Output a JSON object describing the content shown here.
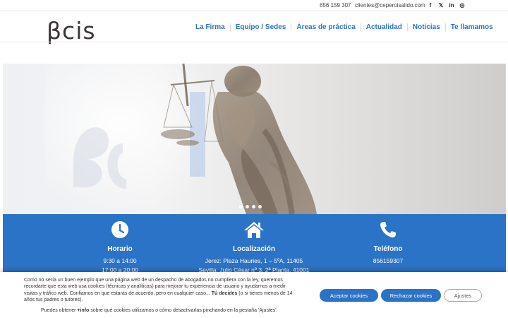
{
  "topbar": {
    "phone": "856 159 307",
    "email": "clientes@ceperoisalido.com",
    "social": [
      {
        "icon": "facebook-icon",
        "glyph": "f"
      },
      {
        "icon": "x-icon",
        "glyph": "𝕏"
      },
      {
        "icon": "linkedin-icon",
        "glyph": "in"
      },
      {
        "icon": "instagram-icon",
        "glyph": "◎"
      }
    ]
  },
  "logo": {
    "text": "βcis"
  },
  "nav": {
    "items": [
      "La Firma",
      "Equipo / Sedes",
      "Áreas de práctica",
      "Actualidad",
      "Noticias",
      "Te llamamos"
    ]
  },
  "hero": {
    "slides": 3,
    "active_slide": 1
  },
  "info": {
    "horario": {
      "icon": "clock-icon",
      "title": "Horario",
      "line1": "9:30 a 14:00",
      "line2": "17:00 a 20:00"
    },
    "localizacion": {
      "icon": "home-icon",
      "title": "Localización",
      "line1": "Jerez: Plaza Hauries, 1 – 5ºA, 11405",
      "line2": "Sevilla: Julio César nº 3, 2ª Planta, 41001"
    },
    "telefono": {
      "icon": "phone-icon",
      "title": "Teléfono",
      "line1": "856159307"
    }
  },
  "cookie": {
    "text_a": "Como no sería un buen ejemplo que una página web de un despacho de abogados no cumpliera con la ley, queremos recordarte que esta web usa cookies (técnicas y analíticas) para mejorar tu experiencia de usuario y ayudarnos a medir visitas y tráfico web. Confiamos en que estarás de acuerdo, pero en cualquier caso... ",
    "text_b": "Tú decides",
    "text_c": " (o si tienes menos de 14 años tus padres o tutores).",
    "more_a": "Puedes obtener ",
    "more_b": "+info",
    "more_c": " sobre qué cookies utilizamos o cómo desactivarlas pinchando en la pestaña 'Ajustes'.",
    "accept_label": "Aceptar cookies",
    "reject_label": "Rechazar cookies",
    "settings_label": "Ajustes"
  },
  "colors": {
    "accent": "#2a73c6",
    "logo": "#3b3535"
  }
}
